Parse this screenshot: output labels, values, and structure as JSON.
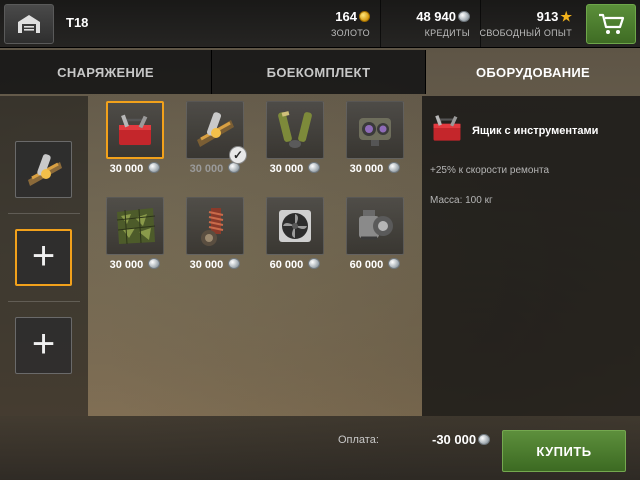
{
  "header": {
    "tank_name": "T18",
    "gold": {
      "value": "164",
      "label": "ЗОЛОТО",
      "icon": "gold-coin-icon"
    },
    "credits": {
      "value": "48 940",
      "label": "КРЕДИТЫ",
      "icon": "silver-coin-icon"
    },
    "free_xp": {
      "value": "913",
      "label": "СВОБОДНЫЙ ОПЫТ",
      "icon": "star-icon"
    },
    "garage_icon": "garage-icon",
    "cart_icon": "cart-icon"
  },
  "tabs": [
    {
      "label": "СНАРЯЖЕНИЕ",
      "active": false
    },
    {
      "label": "БОЕКОМПЛЕКТ",
      "active": false
    },
    {
      "label": "ОБОРУДОВАНИЕ",
      "active": true
    }
  ],
  "slots": [
    {
      "state": "filled",
      "icon": "rammer-icon"
    },
    {
      "state": "empty-selected",
      "icon": "plus-icon"
    },
    {
      "state": "empty",
      "icon": "plus-icon"
    }
  ],
  "items": [
    {
      "icon": "toolbox-icon",
      "price": "30 000",
      "selected": true,
      "owned": false
    },
    {
      "icon": "rammer-icon",
      "price": "30 000",
      "selected": false,
      "owned": true
    },
    {
      "icon": "binocular-telescope-icon",
      "price": "30 000",
      "selected": false,
      "owned": false
    },
    {
      "icon": "coated-optics-icon",
      "price": "30 000",
      "selected": false,
      "owned": false
    },
    {
      "icon": "camouflage-net-icon",
      "price": "30 000",
      "selected": false,
      "owned": false
    },
    {
      "icon": "suspension-icon",
      "price": "30 000",
      "selected": false,
      "owned": false
    },
    {
      "icon": "ventilation-icon",
      "price": "60 000",
      "selected": false,
      "owned": false
    },
    {
      "icon": "gun-laying-drive-icon",
      "price": "60 000",
      "selected": false,
      "owned": false
    }
  ],
  "info": {
    "title": "Ящик с инструментами",
    "effect": "+25% к скорости ремонта",
    "mass": "Масса: 100 кг",
    "icon": "toolbox-icon"
  },
  "footer": {
    "pay_label": "Оплата:",
    "pay_value": "-30 000",
    "buy_label": "КУПИТЬ"
  },
  "colors": {
    "accent_orange": "#f2a11b",
    "buy_green": "#4a7d2e",
    "gold": "#e8b02a"
  }
}
